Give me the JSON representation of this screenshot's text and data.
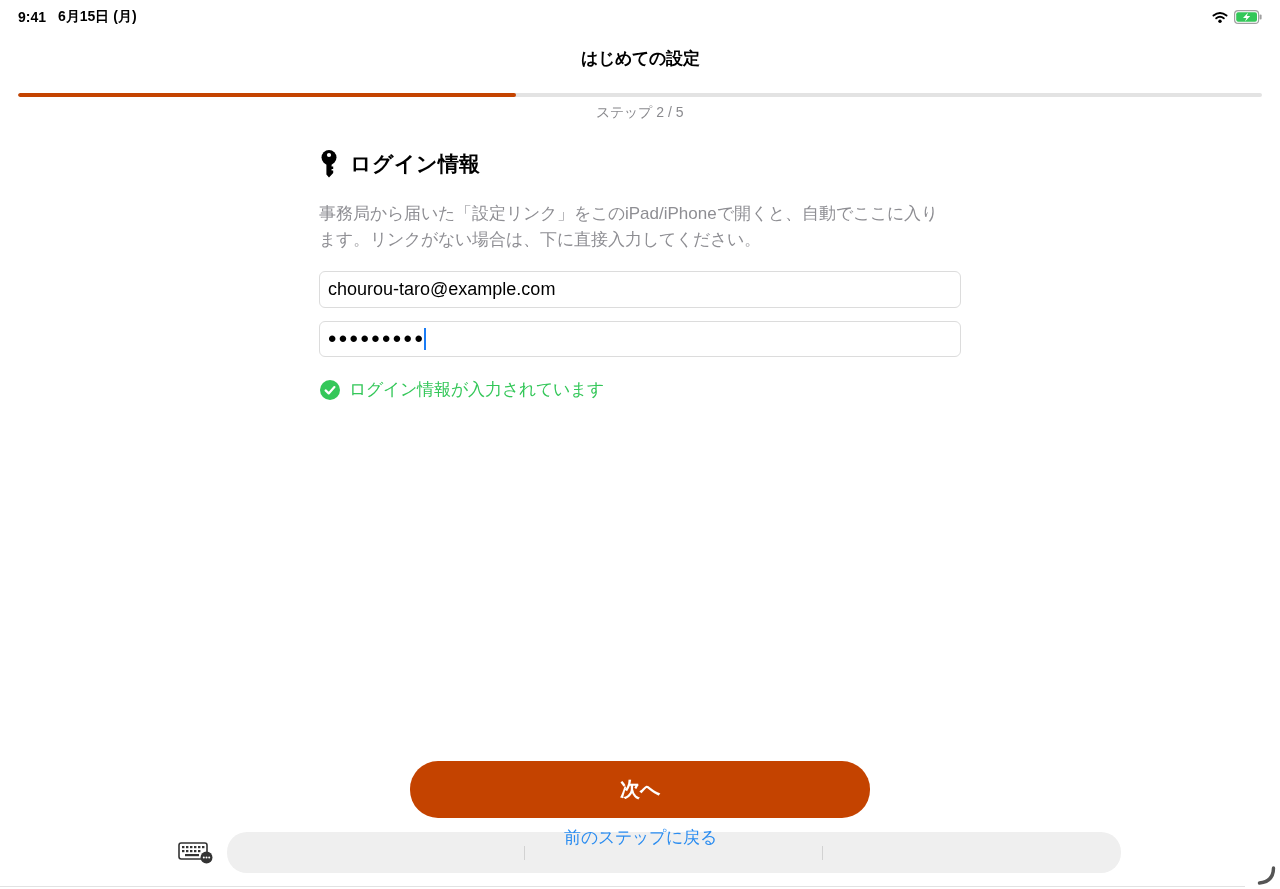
{
  "status_bar": {
    "time": "9:41",
    "date": "6月15日 (月)",
    "battery_charging": true
  },
  "header": {
    "title": "はじめての設定"
  },
  "progress": {
    "level": 0.4,
    "label": "ステップ 2 / 5"
  },
  "section": {
    "title": "ログイン情報",
    "description": "事務局から届いた「設定リンク」をこのiPad/iPhoneで開くと、自動でここに入ります。リンクがない場合は、下に直接入力してください。",
    "fields": [
      {
        "kind": "email",
        "value": "chourou-taro@example.com",
        "focused": false
      },
      {
        "kind": "password",
        "value": "•••••••••",
        "focused": true
      }
    ],
    "status": {
      "kind": "success",
      "text": "ログイン情報が入力されています"
    }
  },
  "actions": {
    "next_button": "次へ",
    "back_link": "前のステップに戻る"
  }
}
